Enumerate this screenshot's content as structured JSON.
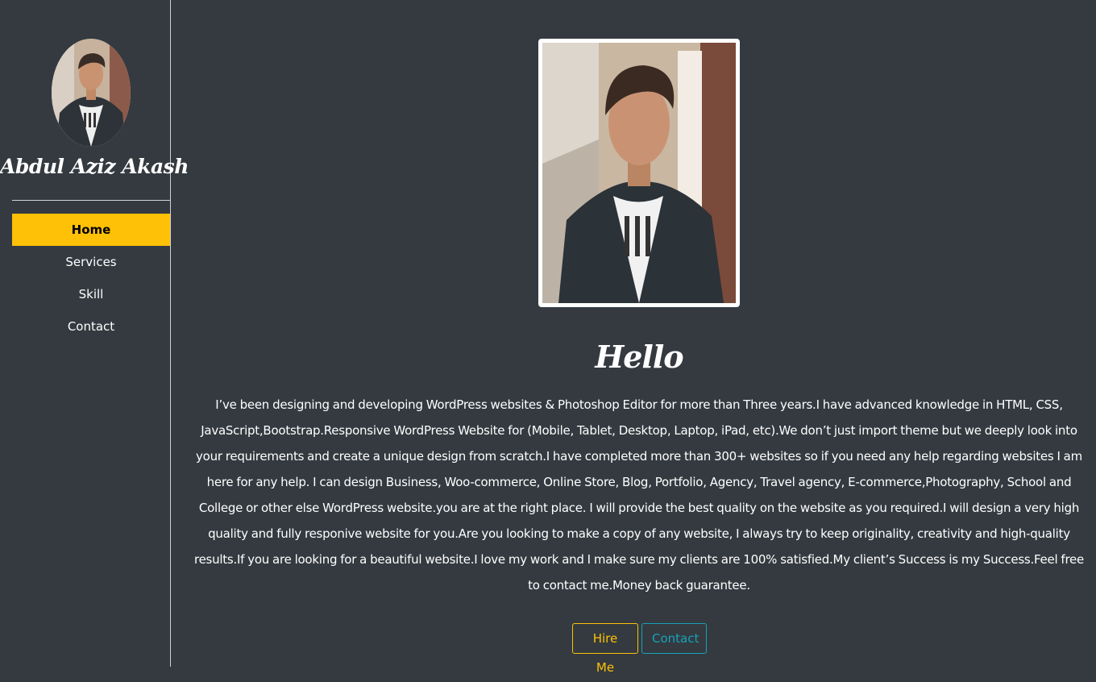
{
  "sidebar": {
    "name": "Abdul Aziz Akash",
    "avatar_icon": "profile-photo",
    "nav": [
      {
        "label": "Home",
        "active": true
      },
      {
        "label": "Services",
        "active": false
      },
      {
        "label": "Skill",
        "active": false
      },
      {
        "label": "Contact",
        "active": false
      }
    ]
  },
  "main": {
    "photo_icon": "profile-photo",
    "heading": "Hello",
    "bio": "I’ve been designing and developing WordPress websites & Photoshop Editor for more than Three years.I have advanced knowledge in HTML, CSS, JavaScript,Bootstrap.Responsive WordPress Website for (Mobile, Tablet, Desktop, Laptop, iPad, etc).We don’t just import theme but we deeply look into your requirements and create a unique design from scratch.I have completed more than 300+ websites so if you need any help regarding websites I am here for any help. I can design Business, Woo-commerce, Online Store, Blog, Portfolio, Agency, Travel agency, E-commerce,Photography, School and College or other else WordPress website.you are at the right place. I will provide the best quality on the website as you required.I will design a very high quality and fully responive website for you.Are you looking to make a copy of any website, I always try to keep originality, creativity and high-quality results.If you are looking for a beautiful website.I love my work and I make sure my clients are 100% satisfied.My client’s Success is my Success.Feel free to contact me.Money back guarantee.",
    "buttons": {
      "hire_label": "Hire Me",
      "contact_label": "Contact"
    }
  },
  "colors": {
    "background": "#343a40",
    "accent_yellow": "#ffc107",
    "accent_teal": "#17a2b8",
    "text": "#ffffff"
  }
}
